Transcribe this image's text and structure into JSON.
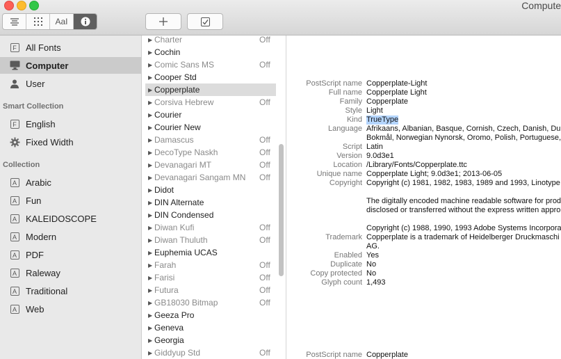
{
  "window": {
    "title": "Compute"
  },
  "toolbar": {
    "text_view_label": "AaI"
  },
  "sidebar": {
    "items": [
      {
        "label": "All Fonts",
        "icon": "font-box-icon"
      },
      {
        "label": "Computer",
        "icon": "monitor-icon",
        "selected": true
      },
      {
        "label": "User",
        "icon": "person-icon"
      }
    ],
    "smart_header": "Smart Collection",
    "smart": [
      {
        "label": "English",
        "icon": "font-box-icon"
      },
      {
        "label": "Fixed Width",
        "icon": "gear-icon"
      }
    ],
    "collection_header": "Collection",
    "collections": [
      {
        "label": "Arabic"
      },
      {
        "label": "Fun"
      },
      {
        "label": "KALEIDOSCOPE"
      },
      {
        "label": "Modern"
      },
      {
        "label": "PDF"
      },
      {
        "label": "Raleway"
      },
      {
        "label": "Traditional"
      },
      {
        "label": "Web"
      }
    ],
    "collection_icon_text": "A",
    "font_icon_text": "F"
  },
  "font_list": [
    {
      "name": "Charter",
      "status": "Off"
    },
    {
      "name": "Cochin",
      "status": ""
    },
    {
      "name": "Comic Sans MS",
      "status": "Off"
    },
    {
      "name": "Cooper Std",
      "status": ""
    },
    {
      "name": "Copperplate",
      "status": "",
      "selected": true
    },
    {
      "name": "Corsiva Hebrew",
      "status": "Off"
    },
    {
      "name": "Courier",
      "status": ""
    },
    {
      "name": "Courier New",
      "status": ""
    },
    {
      "name": "Damascus",
      "status": "Off"
    },
    {
      "name": "DecoType Naskh",
      "status": "Off"
    },
    {
      "name": "Devanagari MT",
      "status": "Off"
    },
    {
      "name": "Devanagari Sangam MN",
      "status": "Off"
    },
    {
      "name": "Didot",
      "status": ""
    },
    {
      "name": "DIN Alternate",
      "status": ""
    },
    {
      "name": "DIN Condensed",
      "status": ""
    },
    {
      "name": "Diwan Kufi",
      "status": "Off"
    },
    {
      "name": "Diwan Thuluth",
      "status": "Off"
    },
    {
      "name": "Euphemia UCAS",
      "status": ""
    },
    {
      "name": "Farah",
      "status": "Off"
    },
    {
      "name": "Farisi",
      "status": "Off"
    },
    {
      "name": "Futura",
      "status": "Off"
    },
    {
      "name": "GB18030 Bitmap",
      "status": "Off"
    },
    {
      "name": "Geeza Pro",
      "status": ""
    },
    {
      "name": "Geneva",
      "status": ""
    },
    {
      "name": "Georgia",
      "status": ""
    },
    {
      "name": "Giddyup Std",
      "status": "Off"
    }
  ],
  "info": [
    {
      "k": "PostScript name",
      "v": "Copperplate-Light"
    },
    {
      "k": "Full name",
      "v": "Copperplate Light"
    },
    {
      "k": "Family",
      "v": "Copperplate"
    },
    {
      "k": "Style",
      "v": "Light"
    },
    {
      "k": "Kind",
      "v": "TrueType",
      "highlight": true
    },
    {
      "k": "Language",
      "v": "Afrikaans, Albanian, Basque, Cornish, Czech, Danish, Du"
    },
    {
      "k": "",
      "v": "Bokmål, Norwegian Nynorsk, Oromo, Polish, Portuguese,"
    },
    {
      "k": "Script",
      "v": "Latin"
    },
    {
      "k": "Version",
      "v": "9.0d3e1"
    },
    {
      "k": "Location",
      "v": "/Library/Fonts/Copperplate.ttc"
    },
    {
      "k": "Unique name",
      "v": "Copperplate Light; 9.0d3e1; 2013-06-05"
    },
    {
      "k": "Copyright",
      "v": "Copyright (c) 1981, 1982, 1983, 1989 and 1993, Linotype"
    },
    {
      "k": "",
      "v": ""
    },
    {
      "k": "",
      "v": "The digitally encoded machine readable software for prod"
    },
    {
      "k": "",
      "v": "disclosed or transferred without the express written appro"
    },
    {
      "k": "",
      "v": ""
    },
    {
      "k": "",
      "v": "Copyright (c) 1988, 1990, 1993 Adobe Systems Incorpora"
    },
    {
      "k": "Trademark",
      "v": "Copperplate is a trademark of Heidelberger Druckmaschi"
    },
    {
      "k": "",
      "v": "AG."
    },
    {
      "k": "Enabled",
      "v": "Yes"
    },
    {
      "k": "Duplicate",
      "v": "No"
    },
    {
      "k": "Copy protected",
      "v": "No"
    },
    {
      "k": "Glyph count",
      "v": "1,493"
    }
  ],
  "info_footer": {
    "k": "PostScript name",
    "v": "Copperplate"
  }
}
